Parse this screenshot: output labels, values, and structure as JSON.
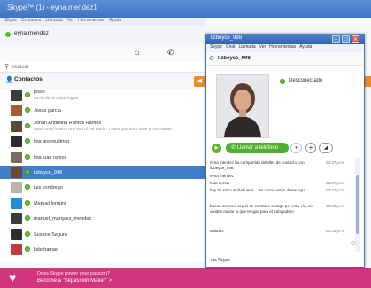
{
  "main_window": {
    "title": "Skype™ (1) - eyna.mendez1",
    "menu": [
      "Skype",
      "Contactos",
      "Llamada",
      "Ver",
      "Herramientas",
      "Ayuda"
    ],
    "user_name": "eyna mendez",
    "search_placeholder": "Buscar",
    "contacts_label": "Contactos"
  },
  "contacts": [
    {
      "name": "jesse",
      "mood": "La familia el mejor regalo",
      "color": "#3b3b3b",
      "selected": false
    },
    {
      "name": "Jesus garcia",
      "mood": "",
      "color": "#a45a38",
      "selected": false
    },
    {
      "name": "Johan Andreina Ramos Ramos",
      "mood": "Watch they mean in the end of the World? Cause you don't have an encounter",
      "color": "#5a4a3a",
      "selected": false
    },
    {
      "name": "lina andreulitrian",
      "mood": "",
      "color": "#2c2c2c",
      "selected": false
    },
    {
      "name": "lina juan ramos",
      "mood": "",
      "color": "#7b6a5d",
      "selected": false
    },
    {
      "name": "lizbeyce_998",
      "mood": "",
      "color": "#6b4a3a",
      "selected": true
    },
    {
      "name": "luis sondrego",
      "mood": "",
      "color": "#b9b2ad",
      "selected": false
    },
    {
      "name": "Manuel lorraini",
      "mood": "",
      "color": "#1f8fd9",
      "selected": false
    },
    {
      "name": "manuel_marquez_mendez",
      "mood": "",
      "color": "#3a3a3a",
      "selected": false
    },
    {
      "name": "Susana Segura",
      "mood": "",
      "color": "#2d2d2d",
      "selected": false
    },
    {
      "name": "lisbohamad",
      "mood": "",
      "color": "#c23b3b",
      "selected": false
    }
  ],
  "banner": {
    "line1": "Does Skype power your passion?",
    "line2": "Become a \"Skpassion Maker\" >"
  },
  "conversation": {
    "title": "lizbeyce_998",
    "menu": [
      "Skype",
      "Chat",
      "Llamada",
      "Ver",
      "Herramientas",
      "Ayuda"
    ],
    "username": "lizbeyce_998",
    "status": "Desconectado",
    "call_label": "Llamar a teléfono",
    "messages": [
      {
        "text": "eyna mendez ha compartido detalles de contacto con lizbeyce_998.",
        "time": "03:27 p.m."
      },
      {
        "text": "eyna mendez",
        "time": ""
      },
      {
        "text": "hola ermita",
        "time": "03:27 p.m."
      },
      {
        "text": "hoy he sido un día fuerte... las cosas están duras aqui...",
        "time": "03:27 p.m."
      },
      {
        "text": "buena mejores seguir en contacto contigo por esta vía, no olvides enviar lo que tengas para el trabajadero",
        "time": "03:28 p.m."
      },
      {
        "text": "saludos",
        "time": "03:28 p.m."
      }
    ],
    "input_placeholder": "",
    "via_label": "vía Skype"
  }
}
